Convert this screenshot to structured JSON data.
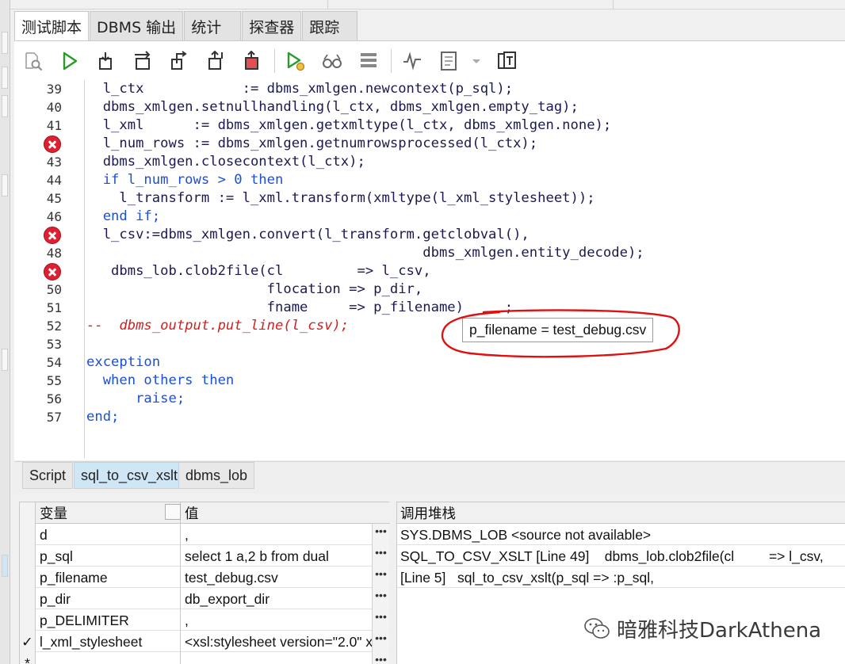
{
  "top_tabs": [
    "测试脚本",
    "DBMS 输出",
    "统计",
    "探查器",
    "跟踪"
  ],
  "toolbar": {
    "icons": [
      "find-icon",
      "run-icon",
      "step-into-icon",
      "step-over-icon",
      "step-out-icon",
      "run-to-exception-icon",
      "halt-icon",
      "debug-run-icon",
      "watch-icon",
      "stack-icon",
      "profiler-icon",
      "report-icon",
      "dropdown-icon",
      "dbms-output-icon"
    ]
  },
  "editor": {
    "line_numbers": [
      "39",
      "40",
      "41",
      "",
      "43",
      "44",
      "45",
      "46",
      "",
      "48",
      "",
      "50",
      "51",
      "52",
      "53",
      "54",
      "55",
      "56",
      "57"
    ],
    "error_lines": [
      3,
      8,
      10
    ],
    "lines": [
      "  l_ctx            := dbms_xmlgen.newcontext(p_sql);",
      "  dbms_xmlgen.setnullhandling(l_ctx, dbms_xmlgen.empty_tag);",
      "  l_xml      := dbms_xmlgen.getxmltype(l_ctx, dbms_xmlgen.none);",
      "  l_num_rows := dbms_xmlgen.getnumrowsprocessed(l_ctx);",
      "  dbms_xmlgen.closecontext(l_ctx);",
      "  if l_num_rows > 0 then",
      "    l_transform := l_xml.transform(xmltype(l_xml_stylesheet));",
      "  end if;",
      "  l_csv:=dbms_xmlgen.convert(l_transform.getclobval(),",
      "                                         dbms_xmlgen.entity_decode);",
      "   dbms_lob.clob2file(cl         => l_csv,",
      "                      flocation => p_dir,",
      "                      fname     => p_filename)     ;",
      "--  dbms_output.put_line(l_csv);",
      "",
      "exception",
      "  when others then",
      "      raise;",
      "end;"
    ],
    "tooltip": "p_filename = test_debug.csv"
  },
  "script_tabs": [
    "Script",
    "sql_to_csv_xslt",
    "dbms_lob"
  ],
  "variables": {
    "col_name": "变量",
    "col_value": "值",
    "rows": [
      {
        "check": "",
        "name": "d",
        "value": ","
      },
      {
        "check": "",
        "name": "p_sql",
        "value": "select 1 a,2 b from dual"
      },
      {
        "check": "",
        "name": "p_filename",
        "value": "test_debug.csv"
      },
      {
        "check": "",
        "name": "p_dir",
        "value": "db_export_dir"
      },
      {
        "check": "",
        "name": "p_DELIMITER",
        "value": ","
      },
      {
        "check": "✓",
        "name": "l_xml_stylesheet",
        "value": "<xsl:stylesheet version=\"2.0\" x"
      },
      {
        "check": "*",
        "name": "",
        "value": ""
      }
    ]
  },
  "call_stack": {
    "title": "调用堆栈",
    "rows": [
      "SYS.DBMS_LOB <source not available>",
      "SQL_TO_CSV_XSLT [Line 49]    dbms_lob.clob2file(cl         => l_csv,",
      "[Line 5]   sql_to_csv_xslt(p_sql => :p_sql,"
    ]
  },
  "watermark": "暗雅科技DarkAthena",
  "colors": {
    "keyword": "#1a4fd8",
    "comment": "#d02020",
    "error": "#e02030",
    "active_tab": "#cfe6f7",
    "highlight_circle": "#e01010"
  }
}
